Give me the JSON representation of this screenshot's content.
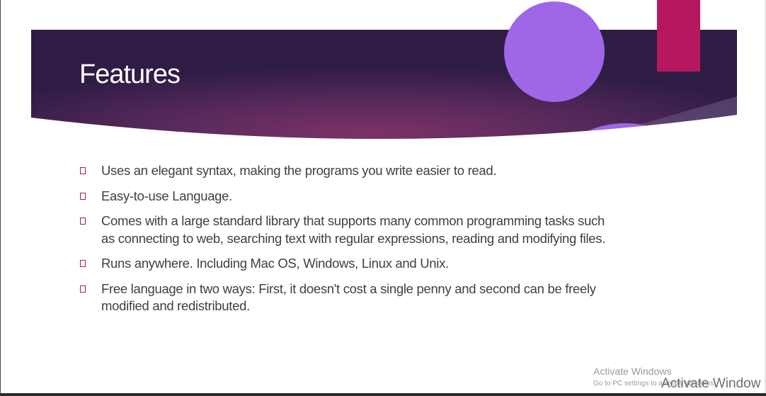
{
  "slide": {
    "title": "Features",
    "bullets": [
      "Uses an elegant syntax, making the programs you write easier to read.",
      "Easy-to-use Language.",
      "Comes with a large standard library that supports many common programming tasks such as connecting to web, searching text with regular expressions, reading and modifying files.",
      "Runs anywhere. Including Mac OS, Windows, Linux and Unix.",
      "Free language in two ways: First, it doesn't cost a single penny and second can be freely modified and redistributed."
    ]
  },
  "watermark": {
    "title": "Activate Windows",
    "subtitle": "Go to PC settings to activate Windows.",
    "overlay": "Activate Window"
  },
  "colors": {
    "banner_dark": "#3a1f4d",
    "banner_mid": "#7a3068",
    "circle": "#a066e8",
    "accent_rect": "#b5185f",
    "bullet_marker": "#a02050",
    "body_text": "#404040"
  }
}
